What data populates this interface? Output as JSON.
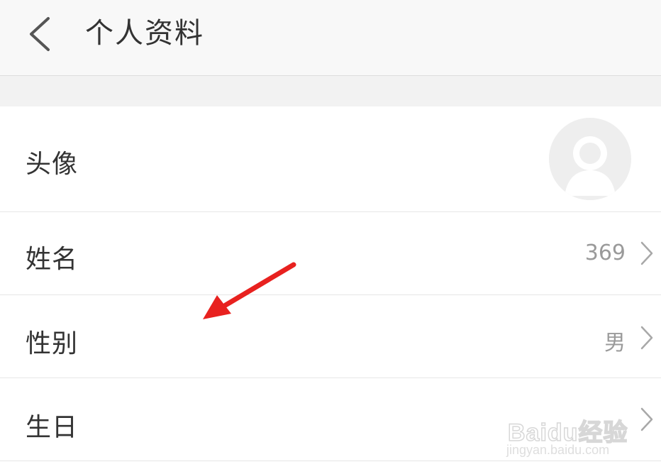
{
  "header": {
    "title": "个人资料",
    "back_icon": "chevron-left-icon"
  },
  "rows": [
    {
      "label": "头像",
      "value": "",
      "kind": "avatar"
    },
    {
      "label": "姓名",
      "value": "369",
      "kind": "text"
    },
    {
      "label": "性别",
      "value": "男",
      "kind": "text"
    },
    {
      "label": "生日",
      "value": "",
      "kind": "text"
    }
  ],
  "annotation": {
    "arrow_color": "#e8211f"
  },
  "watermark": {
    "brand": "Baidu经验",
    "url": "jingyan.baidu.com"
  },
  "colors": {
    "header_bg": "#f8f8f8",
    "section_bg": "#f2f2f2",
    "label_text": "#333333",
    "value_text": "#9a9a9a"
  }
}
